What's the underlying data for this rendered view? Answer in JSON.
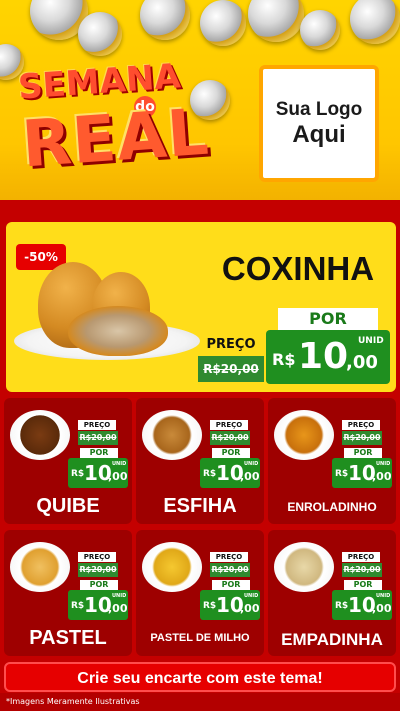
{
  "header": {
    "title_line1": "SEMANA",
    "title_connector": "do",
    "title_line2": "REAL",
    "logo_line1": "Sua Logo",
    "logo_line2": "Aqui"
  },
  "hero": {
    "discount_badge": "-50%",
    "product_name": "COXINHA",
    "preco_label": "PREÇO",
    "old_price": "R$20,00",
    "por_label": "POR",
    "currency": "R$",
    "new_price_int": "10",
    "new_price_dec": ",00",
    "unit": "UNID"
  },
  "products": [
    {
      "name": "QUIBE",
      "preco_label": "PREÇO",
      "old_price": "R$20,00",
      "por_label": "POR",
      "currency": "R$",
      "price_int": "10",
      "price_dec": ",00",
      "unit": "UNID"
    },
    {
      "name": "ESFIHA",
      "preco_label": "PREÇO",
      "old_price": "R$20,00",
      "por_label": "POR",
      "currency": "R$",
      "price_int": "10",
      "price_dec": ",00",
      "unit": "UNID"
    },
    {
      "name": "ENROLADINHO",
      "preco_label": "PREÇO",
      "old_price": "R$20,00",
      "por_label": "POR",
      "currency": "R$",
      "price_int": "10",
      "price_dec": ",00",
      "unit": "UNID"
    },
    {
      "name": "PASTEL",
      "preco_label": "PREÇO",
      "old_price": "R$20,00",
      "por_label": "POR",
      "currency": "R$",
      "price_int": "10",
      "price_dec": ",00",
      "unit": "UNID"
    },
    {
      "name": "PASTEL DE MILHO",
      "preco_label": "PREÇO",
      "old_price": "R$20,00",
      "por_label": "POR",
      "currency": "R$",
      "price_int": "10",
      "price_dec": ",00",
      "unit": "UNID"
    },
    {
      "name": "EMPADINHA",
      "preco_label": "PREÇO",
      "old_price": "R$20,00",
      "por_label": "POR",
      "currency": "R$",
      "price_int": "10",
      "price_dec": ",00",
      "unit": "UNID"
    }
  ],
  "cta": {
    "label": "Crie seu encarte com este tema!"
  },
  "footer": {
    "disclaimer": "*Imagens Meramente Ilustrativas"
  },
  "colors": {
    "yellow": "#ffd400",
    "red": "#c40000",
    "green": "#1f8f1f",
    "dark_red": "#9e0000"
  }
}
